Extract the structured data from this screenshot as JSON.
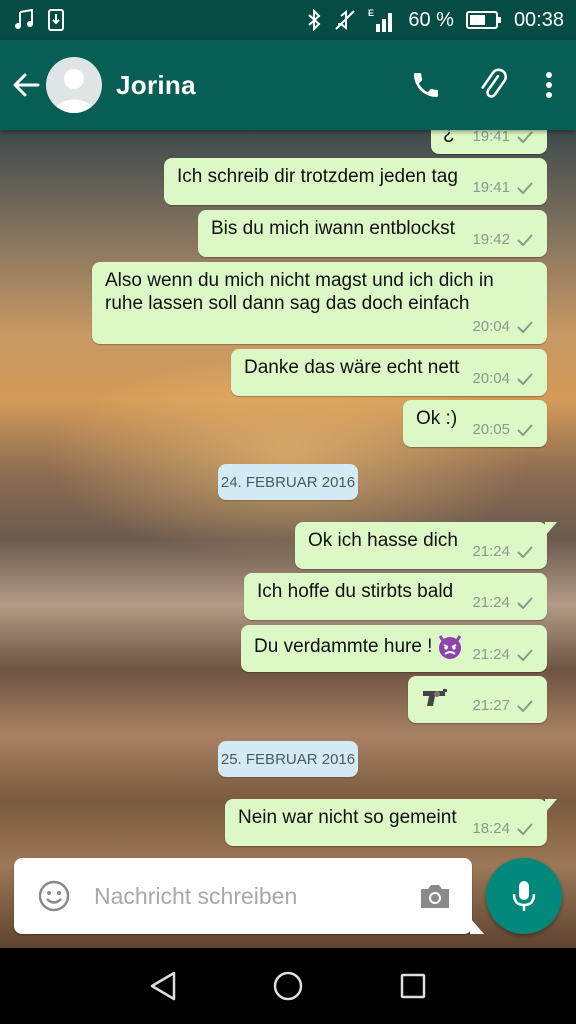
{
  "status": {
    "battery": "60 %",
    "time": "00:38"
  },
  "header": {
    "contact_name": "Jorina"
  },
  "messages": [
    {
      "text": "¿",
      "time": "19:41"
    },
    {
      "text": "Ich schreib dir trotzdem jeden tag",
      "time": "19:41"
    },
    {
      "text": "Bis du mich iwann entblockst",
      "time": "19:42"
    },
    {
      "text": "Also wenn du mich nicht magst und ich dich in ruhe lassen soll dann sag das doch einfach",
      "time": "20:04"
    },
    {
      "text": "Danke das wäre echt nett",
      "time": "20:04"
    },
    {
      "text": "Ok :)",
      "time": "20:05"
    },
    {
      "text": "Ok ich hasse dich",
      "time": "21:24"
    },
    {
      "text": "Ich hoffe du stirbts bald",
      "time": "21:24"
    },
    {
      "text": "Du verdammte hure !",
      "emoji": "angry-devil-emoji",
      "time": "21:24"
    },
    {
      "text": "",
      "emoji": "pistol-emoji",
      "time": "21:27"
    },
    {
      "text": "Nein war nicht so gemeint",
      "time": "18:24"
    }
  ],
  "dates": [
    "24. FEBRUAR 2016",
    "25. FEBRUAR 2016"
  ],
  "composer": {
    "placeholder": "Nachricht schreiben"
  },
  "colors": {
    "header": "#075e54",
    "status_bar": "#054d44",
    "outgoing_bubble": "#dcf8c6",
    "date_chip": "#d4eaf4",
    "mic_button": "#00897b"
  },
  "icons": [
    "music-note-icon",
    "download-icon",
    "bluetooth-icon",
    "mute-icon",
    "signal-icon",
    "battery-icon",
    "back-arrow-icon",
    "avatar-icon",
    "phone-icon",
    "attach-icon",
    "more-vert-icon",
    "emoji-icon",
    "camera-icon",
    "mic-icon",
    "nav-back-icon",
    "nav-home-icon",
    "nav-recents-icon",
    "check-icon"
  ]
}
